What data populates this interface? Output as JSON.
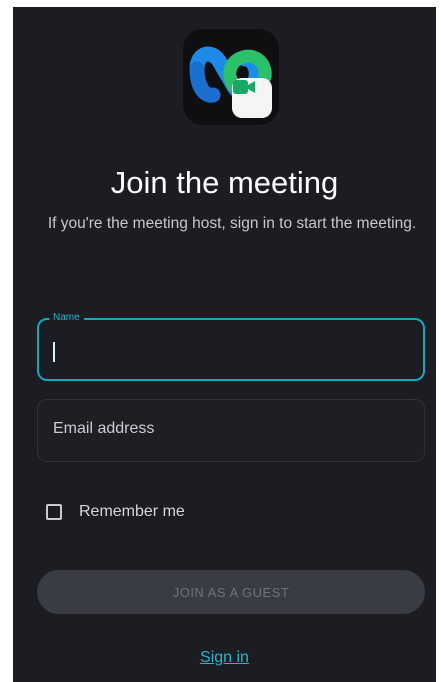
{
  "app": {
    "logo_icon": "webex-logo-icon",
    "badge_icon": "video-camera-icon",
    "colors": {
      "logo_blue": "#1f8be8",
      "logo_green": "#2bc06a",
      "badge_green": "#19a865",
      "accent": "#15a9bd",
      "background": "#1b1d22"
    }
  },
  "header": {
    "title": "Join the meeting",
    "subtitle": "If you're the meeting host, sign in to start the meeting."
  },
  "form": {
    "name_label": "Name",
    "name_value": "",
    "email_placeholder": "Email address",
    "email_value": "",
    "remember_label": "Remember me",
    "remember_checked": false
  },
  "actions": {
    "join_label": "JOIN AS A GUEST",
    "signin_label": "Sign in"
  }
}
